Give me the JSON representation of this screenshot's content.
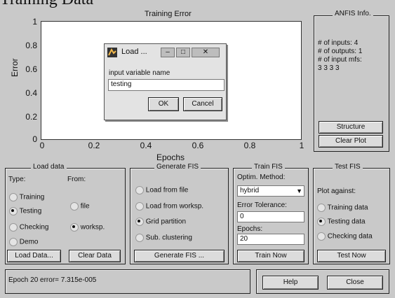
{
  "window_heading": "Training Data",
  "plot": {
    "title": "Training Error",
    "xlabel": "Epochs",
    "ylabel": "Error",
    "yticks": [
      "1",
      "0.8",
      "0.6",
      "0.4",
      "0.2",
      "0"
    ],
    "xticks": [
      "0",
      "0.2",
      "0.4",
      "0.6",
      "0.8",
      "1"
    ]
  },
  "anfis_info": {
    "title": "ANFIS Info.",
    "inputs": "# of inputs: 4",
    "outputs": "# of outputs: 1",
    "input_mfs": "# of input mfs:",
    "mfs_values": "3 3 3 3",
    "structure_label": "Structure",
    "clear_plot_label": "Clear Plot"
  },
  "load_data": {
    "title": "Load data",
    "type_label": "Type:",
    "from_label": "From:",
    "types": [
      "Training",
      "Testing",
      "Checking",
      "Demo"
    ],
    "selected_type": "Testing",
    "from": [
      "file",
      "worksp."
    ],
    "selected_from": "worksp.",
    "load_button": "Load Data...",
    "clear_button": "Clear Data"
  },
  "generate_fis": {
    "title": "Generate FIS",
    "options": [
      "Load from file",
      "Load from worksp.",
      "Grid partition",
      "Sub. clustering"
    ],
    "selected": "Grid partition",
    "button": "Generate FIS ..."
  },
  "train_fis": {
    "title": "Train FIS",
    "method_label": "Optim. Method:",
    "method_value": "hybrid",
    "tolerance_label": "Error Tolerance:",
    "tolerance_value": "0",
    "epochs_label": "Epochs:",
    "epochs_value": "20",
    "button": "Train Now"
  },
  "test_fis": {
    "title": "Test FIS",
    "plot_against_label": "Plot against:",
    "options": [
      "Training data",
      "Testing data",
      "Checking data"
    ],
    "selected": "Testing data",
    "button": "Test Now"
  },
  "status": "Epoch 20 error= 7.315e-005",
  "help_label": "Help",
  "close_label": "Close",
  "dialog": {
    "title": "Load ...",
    "prompt": "input variable name",
    "input_value": "testing",
    "ok_label": "OK",
    "cancel_label": "Cancel"
  }
}
